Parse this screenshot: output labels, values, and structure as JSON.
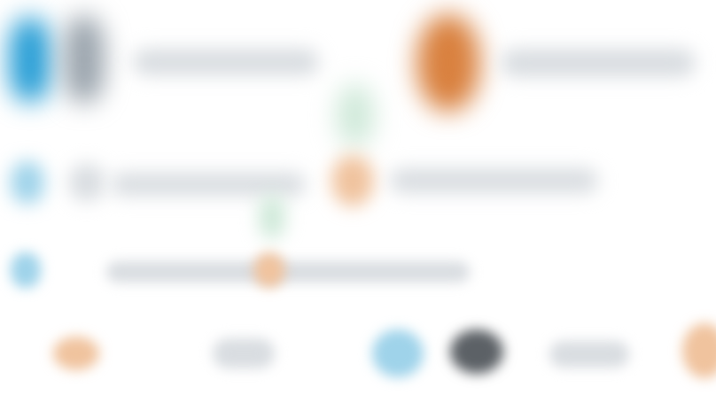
{
  "colors": {
    "background": "#ffffff",
    "blue": "#2a9fd6",
    "blue_light": "#9fd3ea",
    "gray": "#9aa4ad",
    "gray_light": "#d9dde1",
    "orange": "#d9813f",
    "orange_light": "#f0c39e",
    "green_light": "#cfe9d9",
    "dark": "#5c6166"
  },
  "blobs": [
    {
      "name": "row1-blue-shape",
      "color": "blue"
    },
    {
      "name": "row1-gray-shape",
      "color": "gray"
    },
    {
      "name": "row1-text-bar-left",
      "color": "gray_light"
    },
    {
      "name": "row1-orange-shape",
      "color": "orange"
    },
    {
      "name": "row1-text-bar-right",
      "color": "gray_light"
    },
    {
      "name": "row1-green-shape",
      "color": "green_light"
    },
    {
      "name": "row2-blue-shape",
      "color": "blue_light"
    },
    {
      "name": "row2-gray-shape",
      "color": "gray_light"
    },
    {
      "name": "row2-text-bar-left",
      "color": "gray_light"
    },
    {
      "name": "row2-orange-shape",
      "color": "orange_light"
    },
    {
      "name": "row2-text-bar-right",
      "color": "gray_light"
    },
    {
      "name": "row2-green-shape",
      "color": "green_light"
    },
    {
      "name": "row3-blue-shape",
      "color": "blue_light"
    },
    {
      "name": "row3-text-bar",
      "color": "gray_light"
    },
    {
      "name": "row3-orange-shape",
      "color": "orange_light"
    },
    {
      "name": "bottom-orange-shape-left",
      "color": "orange_light"
    },
    {
      "name": "bottom-gray-shape",
      "color": "gray_light"
    },
    {
      "name": "bottom-blue-shape",
      "color": "blue_light"
    },
    {
      "name": "bottom-dark-shape",
      "color": "dark"
    },
    {
      "name": "bottom-gray-shape-right",
      "color": "gray_light"
    },
    {
      "name": "bottom-orange-shape-right",
      "color": "orange_light"
    }
  ]
}
